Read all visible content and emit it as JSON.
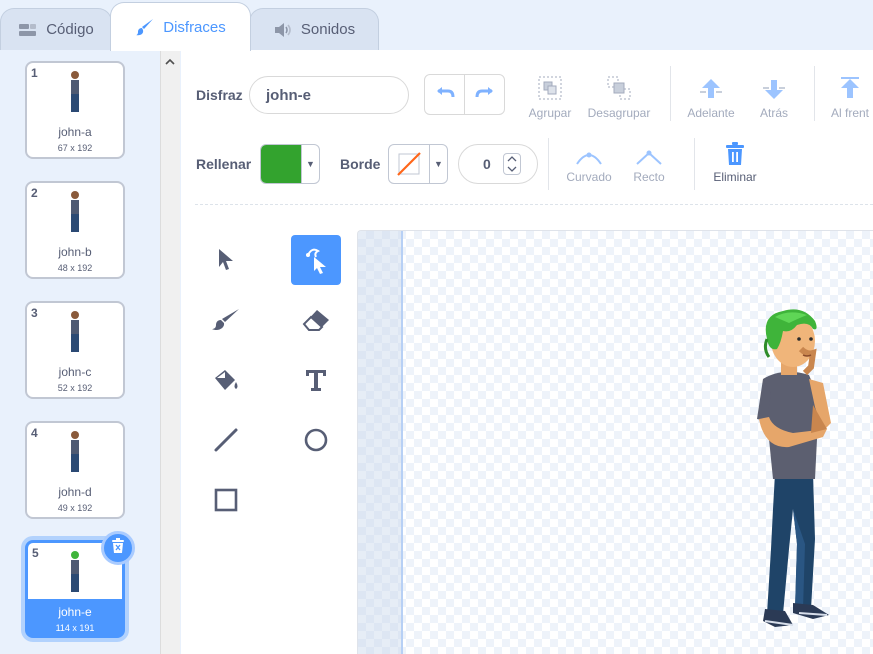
{
  "tabs": [
    {
      "label": "Código",
      "icon": "code-icon"
    },
    {
      "label": "Disfraces",
      "icon": "brush-icon",
      "active": true
    },
    {
      "label": "Sonidos",
      "icon": "speaker-icon"
    }
  ],
  "costumes": [
    {
      "number": "1",
      "name": "john-a",
      "size": "67 x 192"
    },
    {
      "number": "2",
      "name": "john-b",
      "size": "48 x 192"
    },
    {
      "number": "3",
      "name": "john-c",
      "size": "52 x 192"
    },
    {
      "number": "4",
      "name": "john-d",
      "size": "49 x 192"
    },
    {
      "number": "5",
      "name": "john-e",
      "size": "114 x 191",
      "selected": true
    }
  ],
  "toolbar": {
    "costume_label": "Disfraz",
    "costume_name": "john-e",
    "group": "Agrupar",
    "ungroup": "Desagrupar",
    "forward": "Adelante",
    "backward": "Atrás",
    "front": "Al frent",
    "fill_label": "Rellenar",
    "fill_color": "#33a32e",
    "border_label": "Borde",
    "stroke_width": "0",
    "curved": "Curvado",
    "pointed": "Recto",
    "delete": "Eliminar"
  },
  "tools": [
    "select-icon",
    "reshape-icon",
    "brush-icon",
    "eraser-icon",
    "fill-icon",
    "text-icon",
    "line-icon",
    "circle-icon",
    "rectangle-icon"
  ],
  "colors": {
    "accent": "#4c97ff",
    "text": "#575e75",
    "muted": "#a3abbd"
  }
}
